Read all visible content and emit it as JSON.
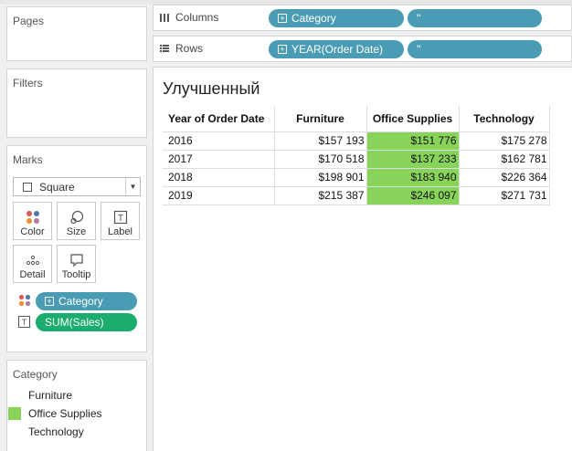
{
  "cards": {
    "pages": "Pages",
    "filters": "Filters",
    "marks": "Marks",
    "legend_title": "Category"
  },
  "shelves": {
    "columns_label": "Columns",
    "rows_label": "Rows",
    "columns_pills": [
      "Category",
      "''"
    ],
    "rows_pills": [
      "YEAR(Order Date)",
      "''"
    ]
  },
  "marks": {
    "mark_type": "Square",
    "buttons": [
      "Color",
      "Size",
      "Label",
      "Detail",
      "Tooltip"
    ],
    "fields": [
      {
        "name": "Category",
        "kind": "color"
      },
      {
        "name": "SUM(Sales)",
        "kind": "label"
      }
    ]
  },
  "legend": {
    "items": [
      {
        "label": "Furniture",
        "color": "#ffffff"
      },
      {
        "label": "Office Supplies",
        "color": "#88d45a"
      },
      {
        "label": "Technology",
        "color": "#ffffff"
      }
    ]
  },
  "view": {
    "title": "Улучшенный",
    "headers": [
      "Year of Order Date",
      "Furniture",
      "Office Supplies",
      "Technology"
    ],
    "rows": [
      {
        "year": "2016",
        "furniture": "$157 193",
        "office": "$151 776",
        "technology": "$175 278"
      },
      {
        "year": "2017",
        "furniture": "$170 518",
        "office": "$137 233",
        "technology": "$162 781"
      },
      {
        "year": "2018",
        "furniture": "$198 901",
        "office": "$183 940",
        "technology": "$226 364"
      },
      {
        "year": "2019",
        "furniture": "$215 387",
        "office": "$246 097",
        "technology": "$271 731"
      }
    ],
    "highlight_color": "#88d45a"
  }
}
